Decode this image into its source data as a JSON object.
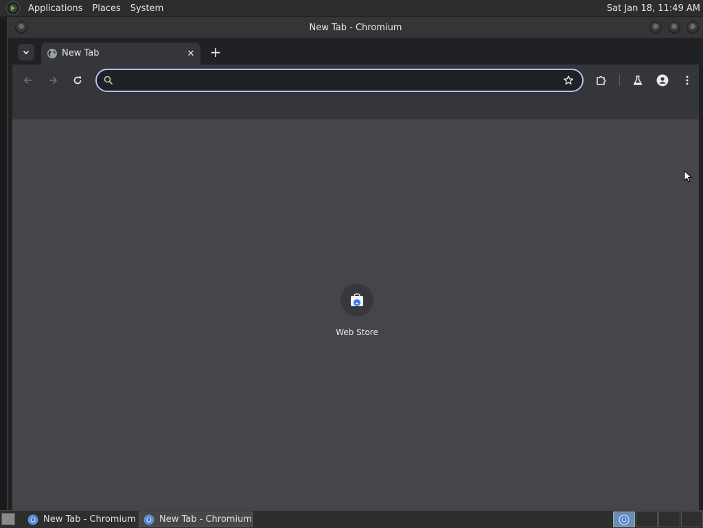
{
  "top_panel": {
    "menus": [
      "Applications",
      "Places",
      "System"
    ],
    "clock": "Sat Jan 18, 11:49 AM"
  },
  "window": {
    "title": "New Tab - Chromium"
  },
  "browser": {
    "tabs": [
      {
        "title": "New Tab",
        "active": true
      }
    ],
    "new_tab_symbol": "+",
    "close_symbol": "✕",
    "omnibox": {
      "value": "",
      "placeholder": ""
    },
    "toolbar_icons": [
      "back-arrow-icon",
      "forward-arrow-icon",
      "reload-icon",
      "bookmark-star-icon",
      "extensions-icon",
      "labs-flask-icon",
      "profile-icon",
      "more-menu-icon"
    ]
  },
  "new_tab_page": {
    "shortcuts": [
      {
        "label": "Web Store",
        "icon": "web-store-icon"
      }
    ]
  },
  "taskbar": {
    "tasks": [
      {
        "label": "New Tab - Chromium",
        "active": false
      },
      {
        "label": "New Tab - Chromium",
        "active": true
      }
    ]
  },
  "colors": {
    "omnibox_focus_ring": "#a8c7fa",
    "content_background": "#45454b",
    "toolbar_background": "#35363a"
  }
}
